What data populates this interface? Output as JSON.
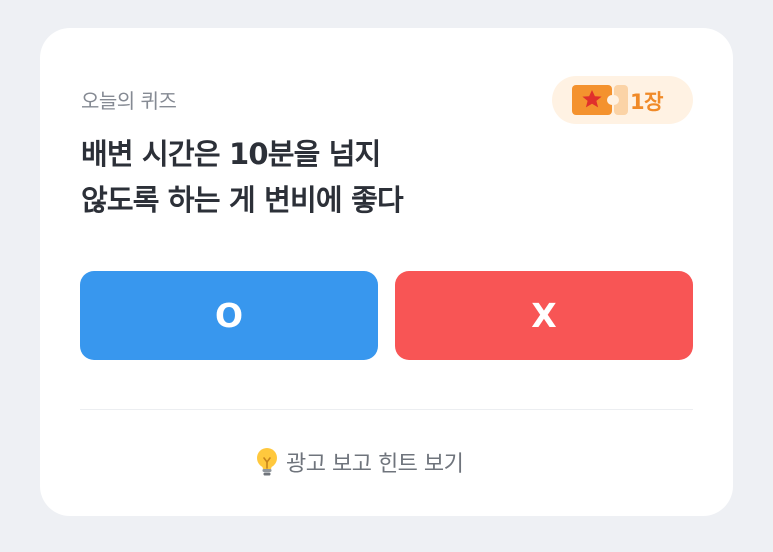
{
  "quiz": {
    "label": "오늘의 퀴즈",
    "ticket_count": "1장",
    "question_lines": [
      "배변 시간은 10분을 넘지",
      "않도록 하는 게 변비에 좋다"
    ],
    "answers": {
      "o_label": "O",
      "x_label": "X"
    },
    "hint_label": "광고 보고 힌트 보기"
  },
  "colors": {
    "accent_blue": "#3897ee",
    "accent_red": "#f85555",
    "ticket_orange": "#f08a28",
    "ticket_bg": "#fff2e3"
  },
  "icons": {
    "ticket": "ticket-star-icon",
    "hint": "lightbulb-icon"
  }
}
